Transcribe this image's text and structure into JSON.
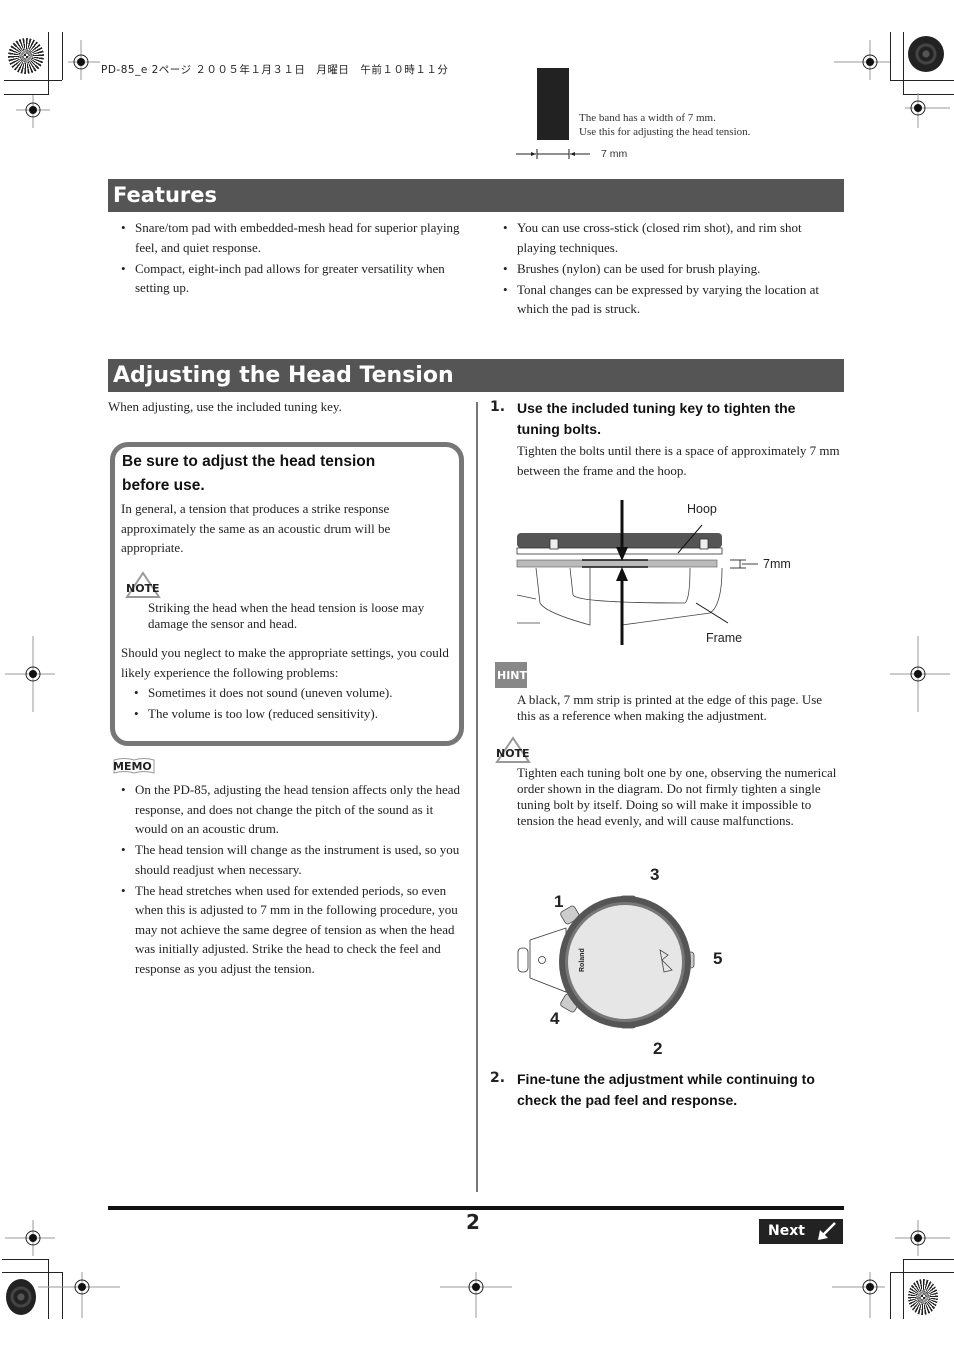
{
  "print_header": "PD-85_e 2ページ ２００５年１月３１日　月曜日　午前１０時１１分",
  "band_reference": {
    "caption_line1": "The band has a width of 7 mm.",
    "caption_line2": "Use this for adjusting the head tension.",
    "dimension_label": "7 mm"
  },
  "features": {
    "title": "Features",
    "left_items": [
      "Snare/tom pad with embedded-mesh head for superior playing feel, and quiet response.",
      "Compact, eight-inch pad allows for greater versatility when setting up."
    ],
    "right_items": [
      "You can use cross-stick (closed rim shot), and rim shot playing techniques.",
      "Brushes (nylon) can be used for brush playing.",
      "Tonal changes can be expressed by varying the location at which the pad is struck."
    ]
  },
  "adjusting": {
    "title": "Adjusting the Head Tension",
    "intro": "When adjusting, use the included tuning key.",
    "box": {
      "title": "Be sure to adjust the head tension before use.",
      "paragraph1": "In general, a tension that produces a strike response approximately the same as an acoustic drum will be appropriate.",
      "note_label": "NOTE",
      "note_text": "Striking the head when the head tension is loose may damage the sensor and head.",
      "paragraph2": "Should you neglect to make the appropriate settings, you could likely experience the following problems:",
      "problems": [
        "Sometimes it does not sound (uneven volume).",
        "The volume is too low (reduced sensitivity)."
      ]
    },
    "memo": {
      "label": "MEMO",
      "items": [
        "On the PD-85, adjusting the head tension affects only the head response, and does not change the pitch of the sound as it would on an acoustic drum.",
        "The head tension will change as the instrument is used, so you should readjust when necessary.",
        "The head stretches when used for extended periods, so even when this is adjusted to 7 mm in the following procedure, you may not achieve the same degree of tension as when the head was initially adjusted. Strike the head to check the feel and response as you adjust the tension."
      ]
    },
    "step1": {
      "number": "1.",
      "title": "Use the included tuning key to tighten the tuning bolts.",
      "body": "Tighten the bolts until there is a space of approximately 7 mm between the frame and the hoop.",
      "diagram": {
        "hoop_label": "Hoop",
        "gap_label": "7mm",
        "frame_label": "Frame"
      }
    },
    "hint": {
      "label": "HINT",
      "text": "A black, 7 mm strip is printed at the edge of this page. Use this as a reference when making the adjustment."
    },
    "note2": {
      "label": "NOTE",
      "text": "Tighten each tuning bolt one by one, observing the numerical order shown in the diagram. Do not firmly tighten a single tuning bolt by itself. Doing so will make it impossible to tension the head evenly, and will cause malfunctions."
    },
    "bolt_diagram": {
      "order_labels": [
        "1",
        "2",
        "3",
        "4",
        "5"
      ],
      "brand": "Roland"
    },
    "step2": {
      "number": "2.",
      "title": "Fine-tune the adjustment while continuing to check the pad feel and response."
    }
  },
  "footer": {
    "page_number": "2",
    "next_label": "Next"
  }
}
